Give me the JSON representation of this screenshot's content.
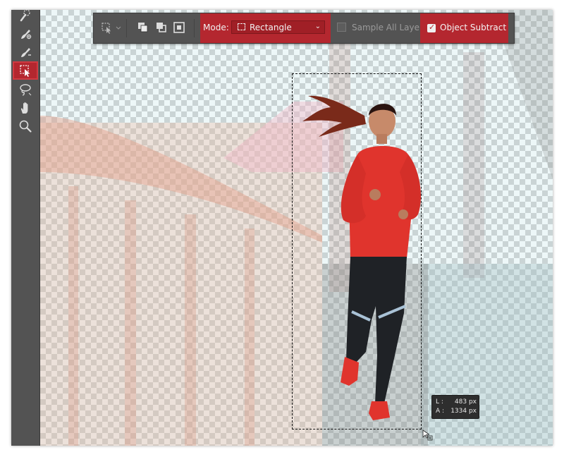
{
  "tools": [
    {
      "icon": "quick-selection-brush-icon"
    },
    {
      "icon": "brush-icon"
    },
    {
      "icon": "brush-minus-icon"
    },
    {
      "icon": "object-selection-icon",
      "active": true
    },
    {
      "icon": "lasso-icon"
    },
    {
      "icon": "hand-icon"
    },
    {
      "icon": "zoom-icon"
    }
  ],
  "options_bar": {
    "mode_label": "Mode:",
    "mode_value": "Rectangle",
    "sample_all_layers_label": "Sample All Layers",
    "sample_all_layers_checked": false,
    "object_subtract_label": "Object Subtract",
    "object_subtract_checked": true
  },
  "size_readout": {
    "width_label": "L :",
    "width_value": "483 px",
    "height_label": "A :",
    "height_value": "1334 px"
  },
  "colors": {
    "highlight": "#b4272f",
    "panel": "#535353"
  }
}
